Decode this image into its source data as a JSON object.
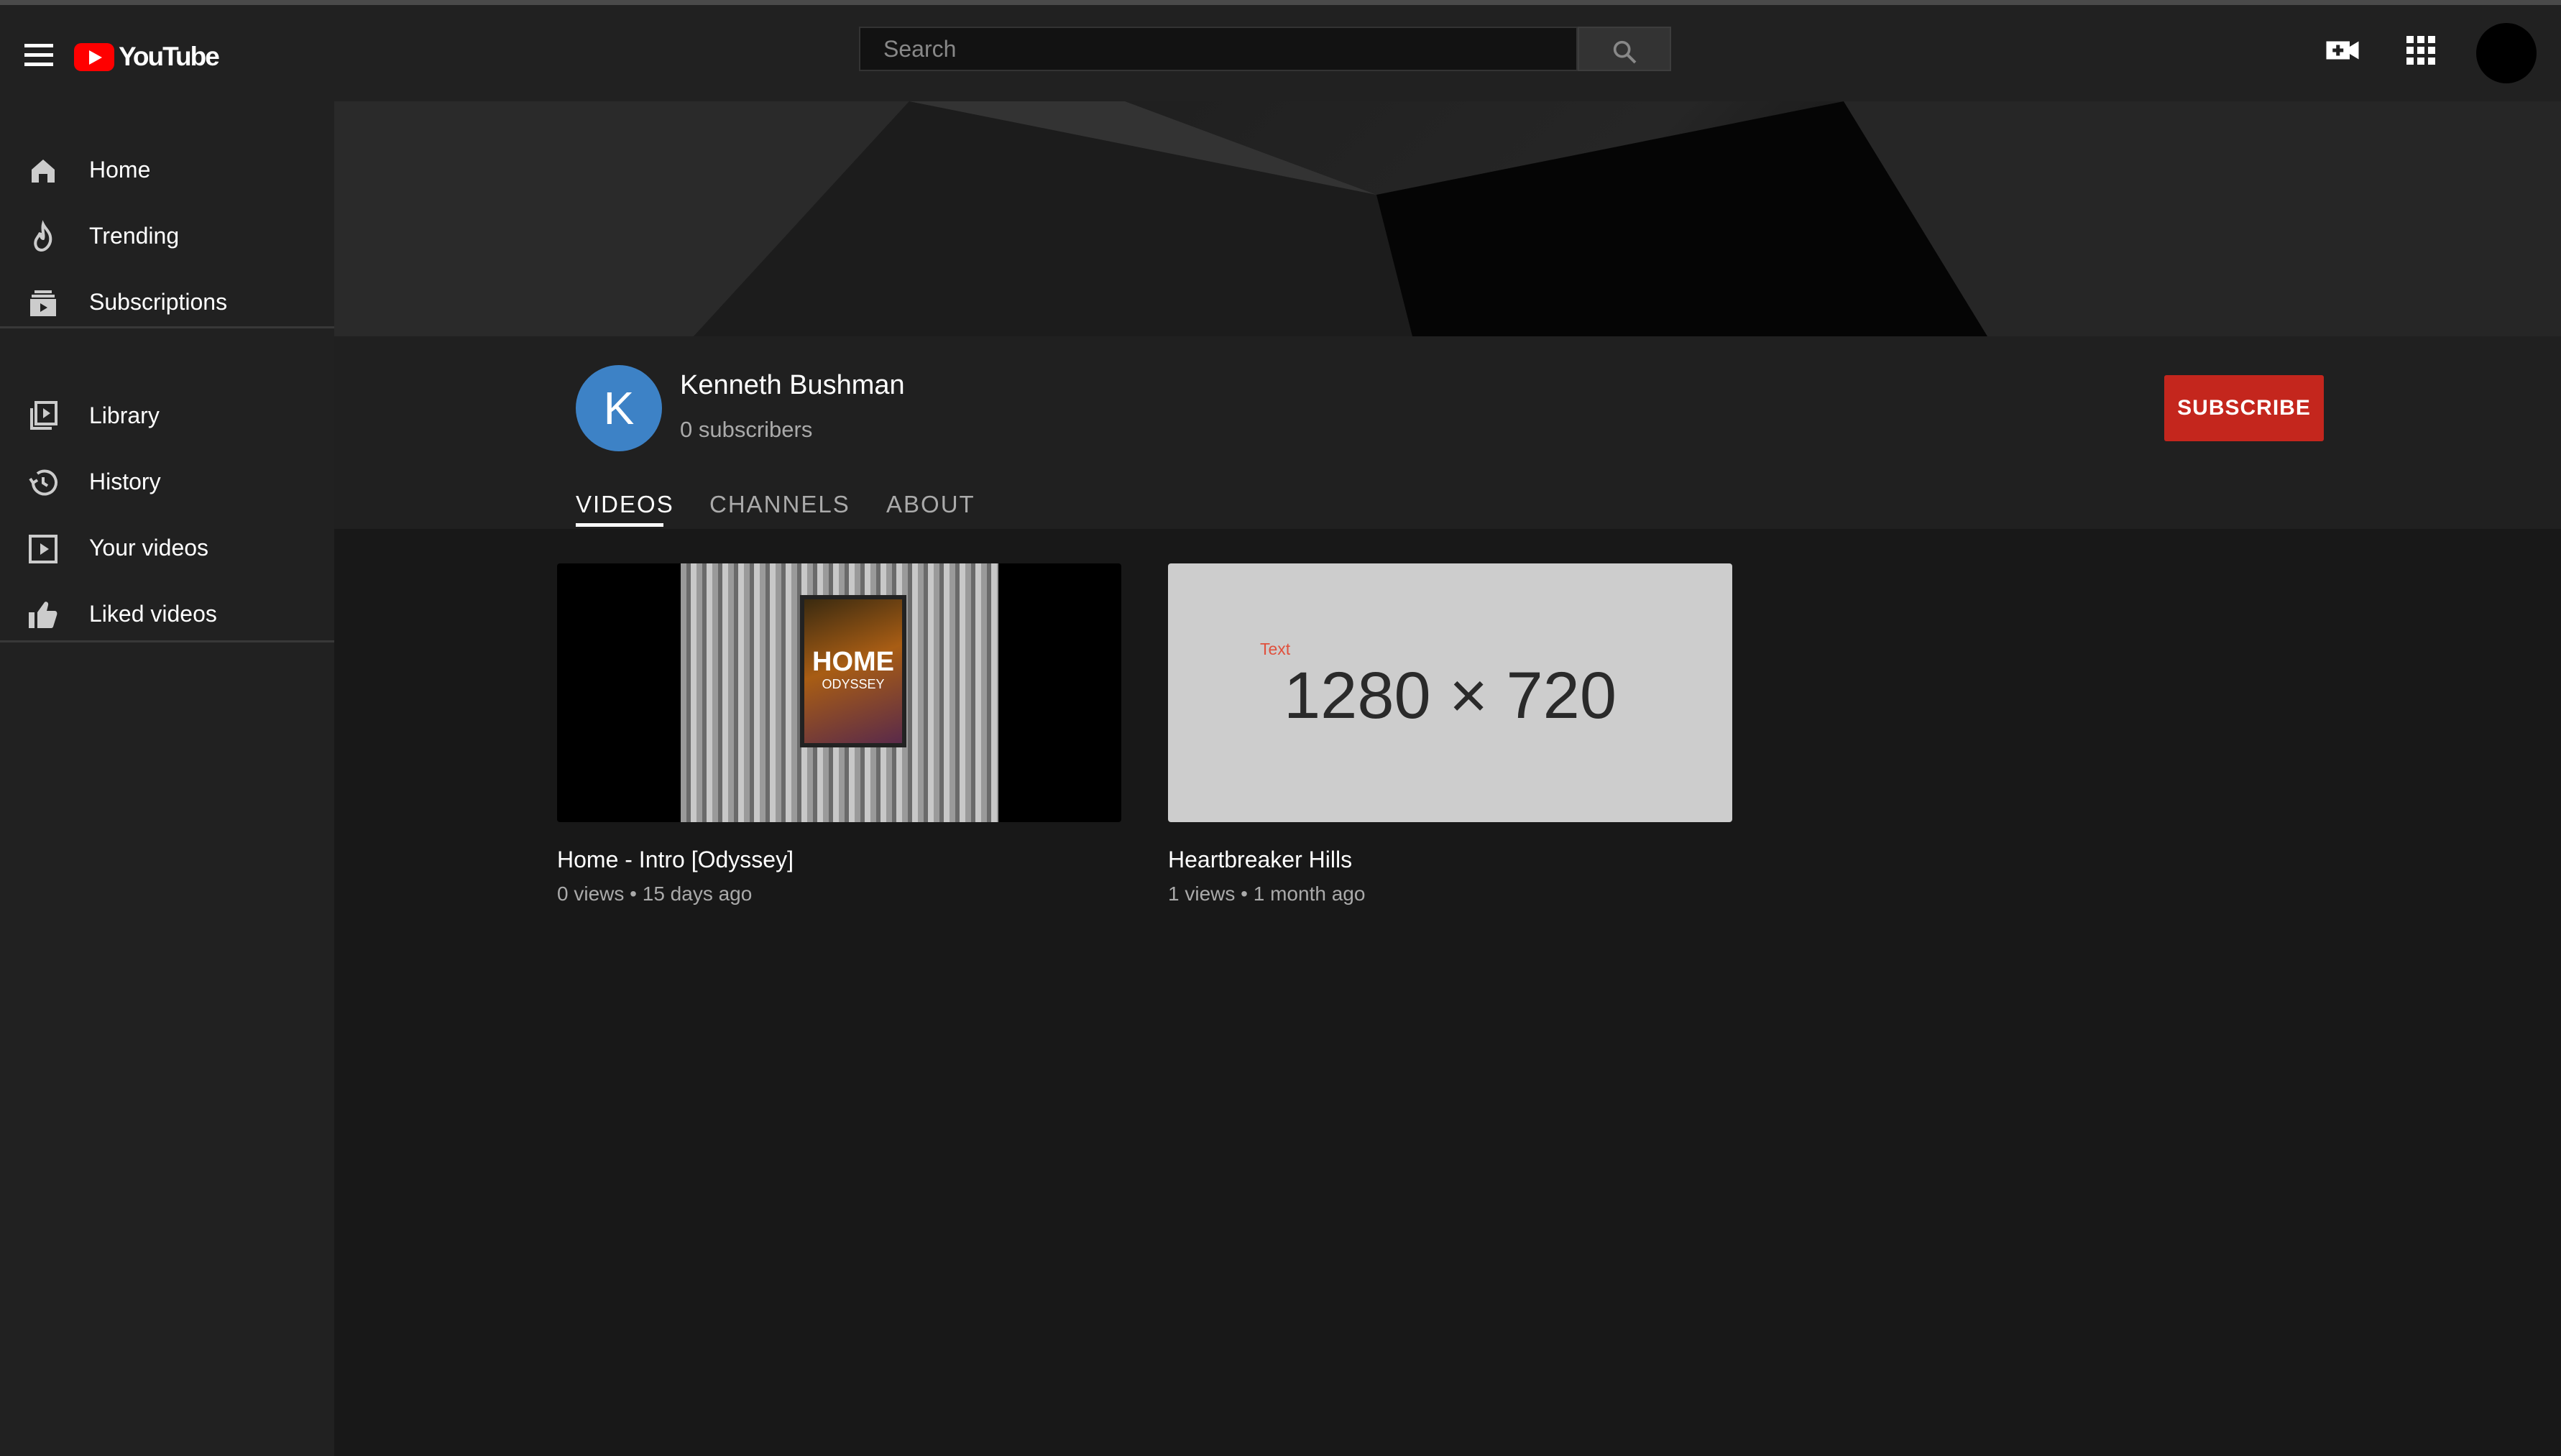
{
  "header": {
    "logo_text": "YouTube",
    "search_placeholder": "Search"
  },
  "sidebar": {
    "items": [
      {
        "label": "Home",
        "icon": "home-icon"
      },
      {
        "label": "Trending",
        "icon": "trending-icon"
      },
      {
        "label": "Subscriptions",
        "icon": "subscriptions-icon"
      },
      {
        "label": "Library",
        "icon": "library-icon"
      },
      {
        "label": "History",
        "icon": "history-icon"
      },
      {
        "label": "Your videos",
        "icon": "your-videos-icon"
      },
      {
        "label": "Liked videos",
        "icon": "liked-videos-icon"
      }
    ]
  },
  "channel": {
    "avatar_letter": "K",
    "name": "Kenneth Bushman",
    "subscribers": "0 subscribers",
    "subscribe_label": "SUBSCRIBE",
    "tabs": [
      "VIDEOS",
      "CHANNELS",
      "ABOUT"
    ]
  },
  "videos": [
    {
      "title": "Home - Intro [Odyssey]",
      "views": "0 views",
      "age": "15 days ago",
      "thumb_text": "HOME",
      "thumb_subtext": "ODYSSEY"
    },
    {
      "title": "Heartbreaker Hills",
      "views": "1 views",
      "age": "1 month ago",
      "thumb_label": "Text",
      "thumb_text": "1280 × 720"
    }
  ],
  "colors": {
    "accent": "#c4261d",
    "avatar": "#3d82c6",
    "background": "#181818",
    "sidebar": "#212121"
  }
}
